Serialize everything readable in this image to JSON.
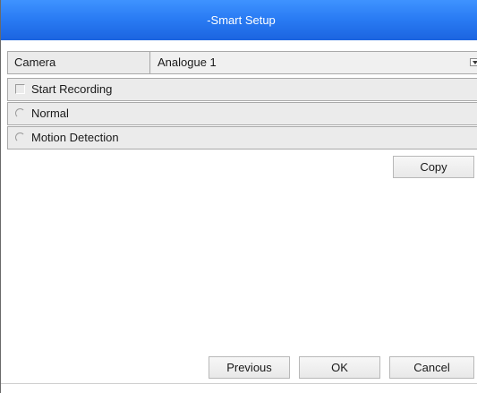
{
  "dialog": {
    "title": "-Smart Setup"
  },
  "camera": {
    "label": "Camera",
    "selected": "Analogue 1"
  },
  "options": {
    "start_recording": "Start Recording",
    "normal": "Normal",
    "motion_detection": "Motion Detection"
  },
  "buttons": {
    "copy": "Copy",
    "previous": "Previous",
    "ok": "OK",
    "cancel": "Cancel"
  },
  "colors": {
    "titlebar": "#2a7cf4",
    "row_background": "#ebebeb"
  }
}
